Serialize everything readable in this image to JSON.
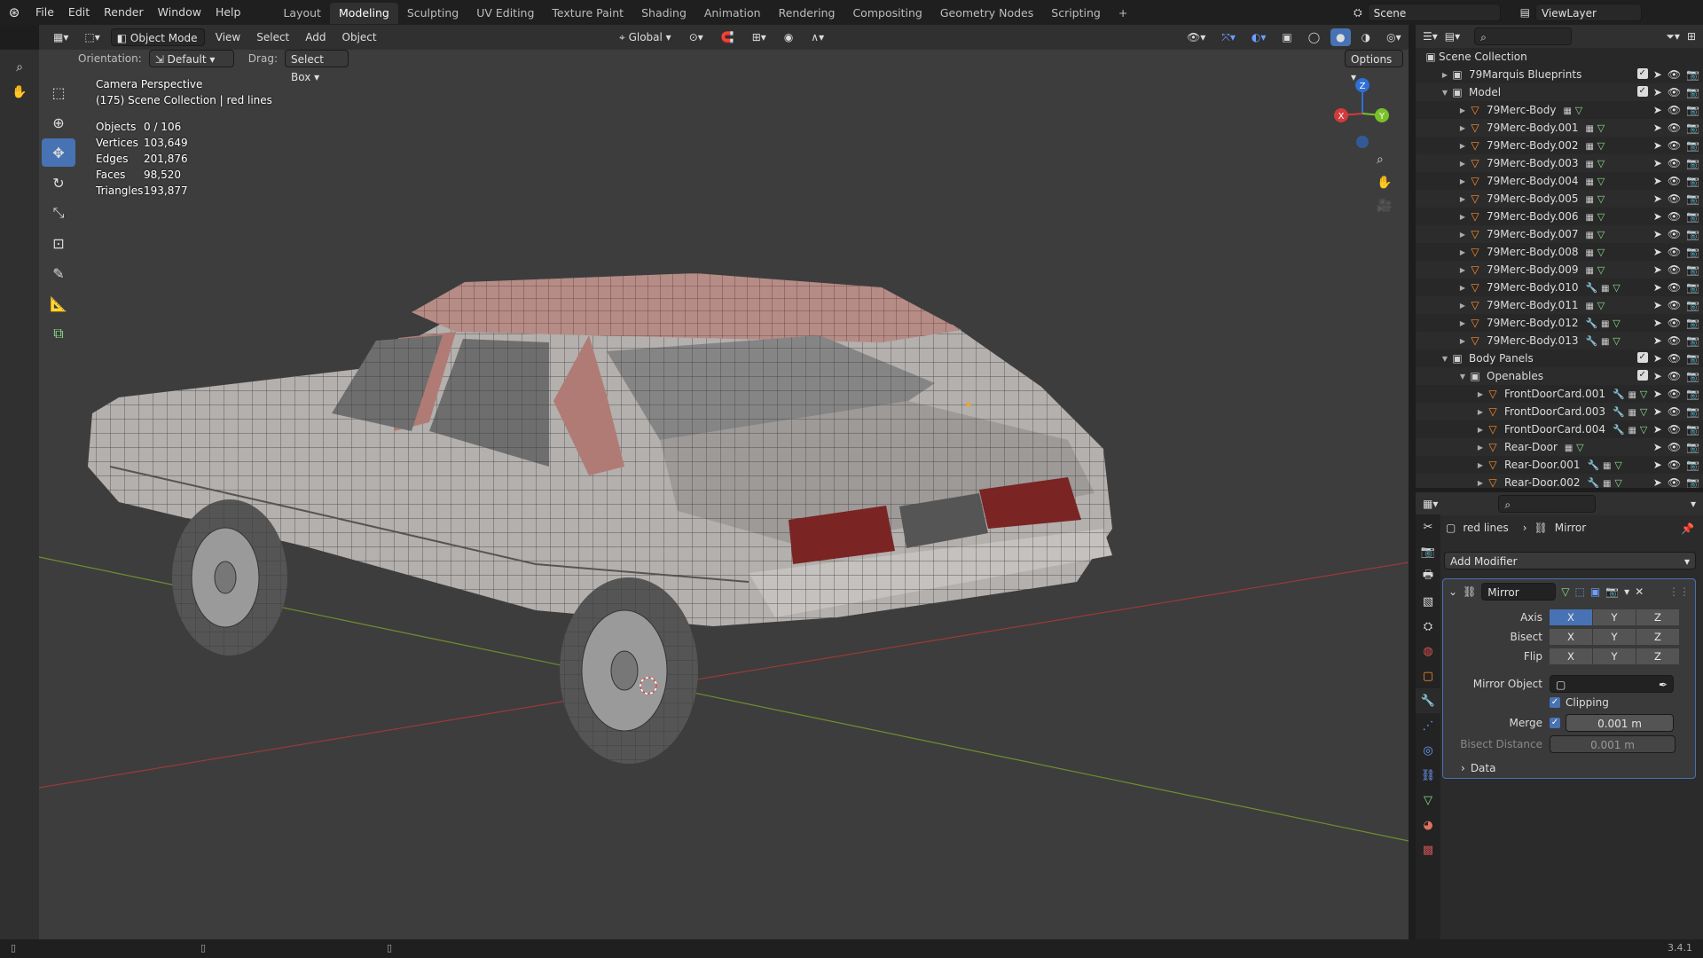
{
  "menubar": {
    "items": [
      "File",
      "Edit",
      "Render",
      "Window",
      "Help"
    ],
    "workspaces": [
      "Layout",
      "Modeling",
      "Sculpting",
      "UV Editing",
      "Texture Paint",
      "Shading",
      "Animation",
      "Rendering",
      "Compositing",
      "Geometry Nodes",
      "Scripting"
    ],
    "active_workspace": "Modeling",
    "add_tab": "+",
    "scene": "Scene",
    "view_layer": "ViewLayer"
  },
  "viewport_header": {
    "mode": "Object Mode",
    "menus": [
      "View",
      "Select",
      "Add",
      "Object"
    ],
    "transform": "Global",
    "orientation_label": "Orientation:",
    "orientation_value": "Default",
    "drag_label": "Drag:",
    "drag_value": "Select Box",
    "options": "Options"
  },
  "overlay": {
    "title": "Camera Perspective",
    "subtitle": "(175) Scene Collection | red lines",
    "stats": [
      {
        "k": "Objects",
        "v": "0 / 106"
      },
      {
        "k": "Vertices",
        "v": "103,649"
      },
      {
        "k": "Edges",
        "v": "201,876"
      },
      {
        "k": "Faces",
        "v": "98,520"
      },
      {
        "k": "Triangles",
        "v": "193,877"
      }
    ]
  },
  "gizmo": {
    "x": "X",
    "y": "Y",
    "z": "Z"
  },
  "outliner": {
    "root": "Scene Collection",
    "rows": [
      {
        "label": "79Marquis Blueprints",
        "depth": 1,
        "kind": "collection",
        "expanded": false
      },
      {
        "label": "Model",
        "depth": 1,
        "kind": "collection",
        "expanded": true
      },
      {
        "label": "79Merc-Body",
        "depth": 2,
        "kind": "mesh"
      },
      {
        "label": "79Merc-Body.001",
        "depth": 2,
        "kind": "mesh"
      },
      {
        "label": "79Merc-Body.002",
        "depth": 2,
        "kind": "mesh"
      },
      {
        "label": "79Merc-Body.003",
        "depth": 2,
        "kind": "mesh"
      },
      {
        "label": "79Merc-Body.004",
        "depth": 2,
        "kind": "mesh"
      },
      {
        "label": "79Merc-Body.005",
        "depth": 2,
        "kind": "mesh"
      },
      {
        "label": "79Merc-Body.006",
        "depth": 2,
        "kind": "mesh"
      },
      {
        "label": "79Merc-Body.007",
        "depth": 2,
        "kind": "mesh"
      },
      {
        "label": "79Merc-Body.008",
        "depth": 2,
        "kind": "mesh"
      },
      {
        "label": "79Merc-Body.009",
        "depth": 2,
        "kind": "mesh"
      },
      {
        "label": "79Merc-Body.010",
        "depth": 2,
        "kind": "mesh",
        "modifier": true
      },
      {
        "label": "79Merc-Body.011",
        "depth": 2,
        "kind": "mesh"
      },
      {
        "label": "79Merc-Body.012",
        "depth": 2,
        "kind": "mesh",
        "modifier": true
      },
      {
        "label": "79Merc-Body.013",
        "depth": 2,
        "kind": "mesh",
        "modifier": true
      },
      {
        "label": "Body Panels",
        "depth": 1,
        "kind": "collection",
        "expanded": true
      },
      {
        "label": "Openables",
        "depth": 2,
        "kind": "collection",
        "expanded": true
      },
      {
        "label": "FrontDoorCard.001",
        "depth": 3,
        "kind": "mesh",
        "modifier": true
      },
      {
        "label": "FrontDoorCard.003",
        "depth": 3,
        "kind": "mesh",
        "modifier": true
      },
      {
        "label": "FrontDoorCard.004",
        "depth": 3,
        "kind": "mesh",
        "modifier": true
      },
      {
        "label": "Rear-Door",
        "depth": 3,
        "kind": "mesh"
      },
      {
        "label": "Rear-Door.001",
        "depth": 3,
        "kind": "mesh",
        "modifier": true
      },
      {
        "label": "Rear-Door.002",
        "depth": 3,
        "kind": "mesh",
        "modifier": true
      }
    ]
  },
  "properties": {
    "breadcrumb_object": "red lines",
    "breadcrumb_modifier": "Mirror",
    "add_modifier": "Add Modifier",
    "modifier_name": "Mirror",
    "axis_label": "Axis",
    "bisect_label": "Bisect",
    "flip_label": "Flip",
    "axes": [
      "X",
      "Y",
      "Z"
    ],
    "mirror_object_label": "Mirror Object",
    "clipping_label": "Clipping",
    "merge_label": "Merge",
    "merge_value": "0.001 m",
    "bisect_distance_label": "Bisect Distance",
    "bisect_distance_value": "0.001 m",
    "data_label": "Data"
  },
  "status": {
    "version": "3.4.1"
  }
}
